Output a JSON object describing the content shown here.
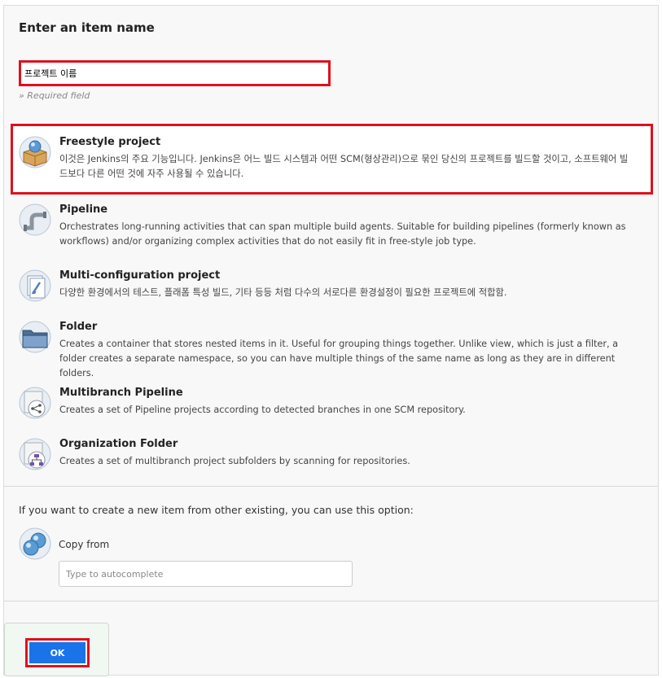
{
  "header": {
    "title": "Enter an item name"
  },
  "name_field": {
    "value": "프로젝트 이름",
    "hint": "» Required field"
  },
  "items": [
    {
      "title": "Freestyle project",
      "icon": "freestyle-project-icon",
      "description": "이것은 Jenkins의 주요 기능입니다. Jenkins은 어느 빌드 시스템과 어떤 SCM(형상관리)으로 묶인 당신의 프로젝트를 빌드할 것이고, 소프트웨어 빌드보다 다른 어떤 것에 자주 사용될 수 있습니다."
    },
    {
      "title": "Pipeline",
      "icon": "pipeline-icon",
      "description": "Orchestrates long-running activities that can span multiple build agents. Suitable for building pipelines (formerly known as workflows) and/or organizing complex activities that do not easily fit in free-style job type."
    },
    {
      "title": "Multi-configuration project",
      "icon": "multi-configuration-icon",
      "description": "다양한 환경에서의 테스트, 플래폼 특성 빌드, 기타 등등 처럼 다수의 서로다른 환경설정이 필요한 프로젝트에 적합함."
    },
    {
      "title": "Folder",
      "icon": "folder-icon",
      "description": "Creates a container that stores nested items in it. Useful for grouping things together. Unlike view, which is just a filter, a folder creates a separate namespace, so you can have multiple things of the same name as long as they are in different folders."
    },
    {
      "title": "Multibranch Pipeline",
      "icon": "multibranch-pipeline-icon",
      "description": "Creates a set of Pipeline projects according to detected branches in one SCM repository."
    },
    {
      "title": "Organization Folder",
      "icon": "organization-folder-icon",
      "description": "Creates a set of multibranch project subfolders by scanning for repositories."
    }
  ],
  "copy": {
    "text": "If you want to create a new item from other existing, you can use this option:",
    "label": "Copy from",
    "placeholder": "Type to autocomplete"
  },
  "footer": {
    "ok_label": "OK"
  },
  "colors": {
    "highlight": "#e0101c",
    "ok_button": "#1a73e8"
  }
}
